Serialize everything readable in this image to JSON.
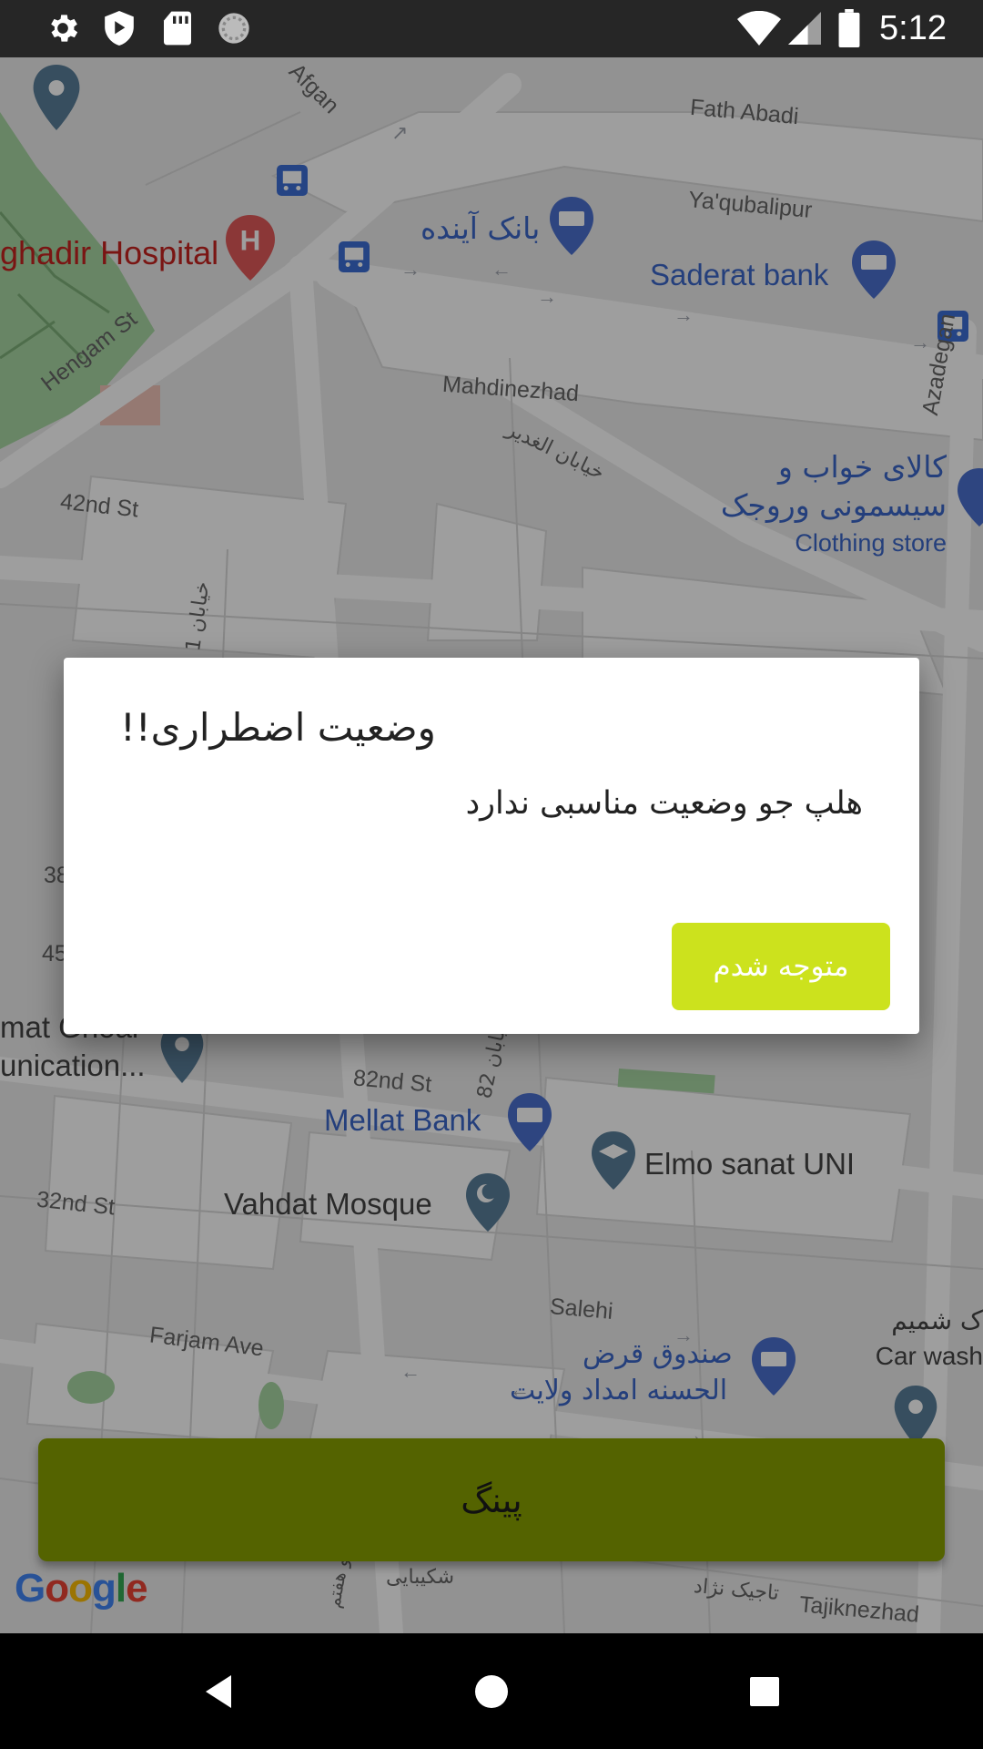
{
  "status_bar": {
    "time": "5:12",
    "icons_left": [
      "gear-icon",
      "shield-icon",
      "sd-card-icon",
      "sync-icon"
    ],
    "icons_right": [
      "wifi-icon",
      "signal-icon",
      "battery-icon"
    ]
  },
  "map": {
    "labels": {
      "afgan": "Afgan",
      "fath_abadi": "Fath Abadi",
      "yaqubalipur": "Ya'qubalipur",
      "bank_ayandeh": "بانک آینده",
      "saderat_bank": "Saderat bank",
      "ghadir_hospital": "ghadir Hospital",
      "hengam_st": "Hengam St",
      "mahdinezhad": "Mahdinezhad",
      "khiaban_ghadir": "خیابان الغدیر",
      "azadegan": "Azadegan",
      "kalaye_khab_1": "کالای خواب و",
      "kalaye_khab_2": "سیسمونی وروجک",
      "clothing_store": "Clothing store",
      "st_42": "42nd St",
      "khiaban_1": "خیابان 1",
      "num_38": "38",
      "num_45": "45",
      "mat_ghoal_1": "mat Ghoal",
      "mat_ghoal_2": "unication...",
      "st_82": "82nd St",
      "khiaban_82": "خیابان 82",
      "mellat_bank": "Mellat Bank",
      "elmo_sanat": "Elmo sanat UNI",
      "st_32": "32nd St",
      "vahdat_mosque": "Vahdat Mosque",
      "salehi": "Salehi",
      "farjam_ave": "Farjam Ave",
      "sandogh_1": "صندوق قرض",
      "sandogh_2": "الحسنه امداد ولایت",
      "car_wash_fa": "ک شمیم",
      "car_wash": "Car wash",
      "shakibaee": "شکیبایی",
      "tajiknezhad_fa": "تاجیک نژاد",
      "tajiknezhad": "Tajiknezhad",
      "haftom": "و هفتم"
    },
    "google_logo": [
      "G",
      "o",
      "o",
      "g",
      "l",
      "e"
    ]
  },
  "ping_button": {
    "label": "پینگ"
  },
  "dialog": {
    "title": "وضعیت اضطراری!!",
    "message": "هلپ جو وضعیت مناسبی ندارد",
    "button_label": "متوجه شدم"
  },
  "nav_bar": {
    "buttons": [
      "back-icon",
      "home-icon",
      "recents-icon"
    ]
  },
  "colors": {
    "dialog_button": "#cce21d",
    "ping_button": "#546300",
    "status_bar": "#262626",
    "nav_bar": "#000000"
  }
}
